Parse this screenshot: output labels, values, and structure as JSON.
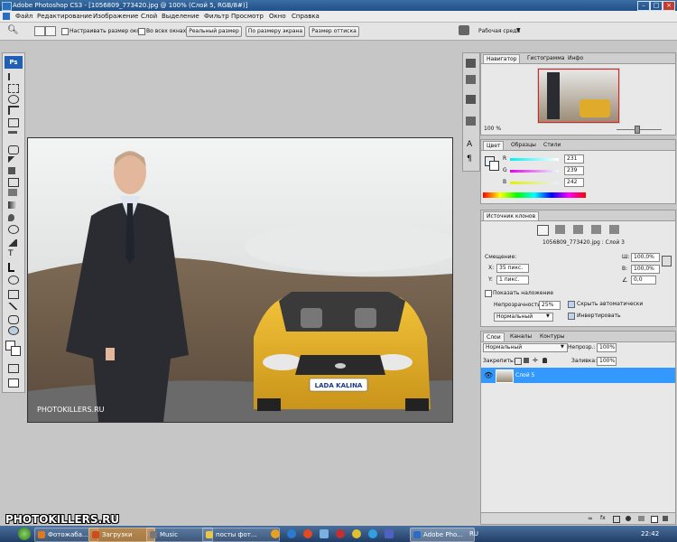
{
  "window": {
    "title": "Adobe Photoshop CS3 - [1056809_773420.jpg @ 100% (Слой 5, RGB/8#)]"
  },
  "menu": [
    "Файл",
    "Редактирование",
    "Изображение",
    "Слой",
    "Выделение",
    "Фильтр",
    "Просмотр",
    "Окно",
    "Справка"
  ],
  "options": {
    "resize_windows": "Настраивать размер окон",
    "all_windows": "Во всех окнах",
    "actual_pixels": "Реальный размер",
    "fit_screen": "По размеру экрана",
    "print_size": "Размер оттиска",
    "workspace": "Рабочая среда"
  },
  "canvas": {
    "watermark": "PHOTOKILLERS.RU",
    "plate": "LADA KALINA"
  },
  "navigator": {
    "tabs": [
      "Навигатор",
      "Гистограмма",
      "Инфо"
    ],
    "zoom": "100 %"
  },
  "color": {
    "tabs": [
      "Цвет",
      "Образцы",
      "Стили"
    ],
    "channels": [
      {
        "name": "R",
        "value": "231",
        "level": 0.906
      },
      {
        "name": "G",
        "value": "239",
        "level": 0.937
      },
      {
        "name": "B",
        "value": "242",
        "level": 0.949
      }
    ]
  },
  "clone": {
    "tab": "Источник клонов",
    "file": "1056809_773420.jpg : Слой 3",
    "offset_label": "Смещение:",
    "x_label": "X:",
    "x": "35 пикс.",
    "y_label": "Y:",
    "y": "1 пикс.",
    "w_label": "Ш:",
    "w": "100,0%",
    "h_label": "В:",
    "h": "100,0%",
    "angle": "0,0",
    "show_overlay": "Показать наложение",
    "opacity_label": "Непрозрачность:",
    "opacity": "25%",
    "auto_hide": "Скрыть автоматически",
    "mode": "Нормальный",
    "invert": "Инвертировать"
  },
  "layers": {
    "tabs": [
      "Слои",
      "Каналы",
      "Контуры"
    ],
    "blend": "Нормальный",
    "opacity_label": "Непрозр.:",
    "opacity": "100%",
    "lock_label": "Закрепить:",
    "fill_label": "Заливка:",
    "fill": "100%",
    "layer_name": "Слой 5"
  },
  "taskbar": {
    "items": [
      "Фотожаба...",
      "Загрузки",
      "Music",
      "посты фот...",
      "Adobe Pho..."
    ],
    "lang": "RU",
    "time": "22:42"
  },
  "watermark": "PHOTOKILLERS.RU"
}
